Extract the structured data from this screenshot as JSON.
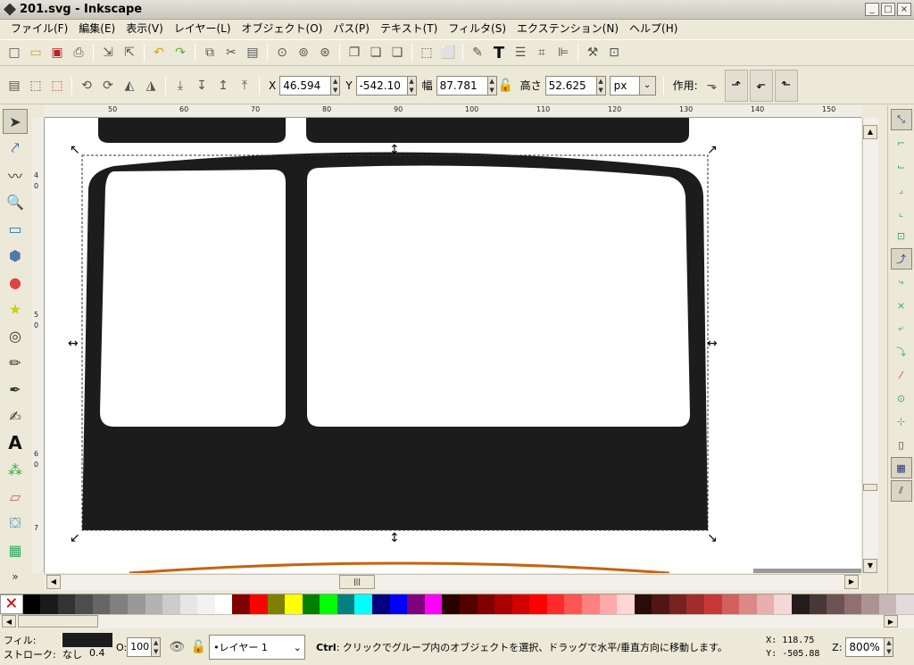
{
  "window": {
    "title": "201.svg - Inkscape",
    "minimize": "_",
    "maximize": "□",
    "close": "×"
  },
  "menu": [
    "ファイル(F)",
    "編集(E)",
    "表示(V)",
    "レイヤー(L)",
    "オブジェクト(O)",
    "パス(P)",
    "テキスト(T)",
    "フィルタ(S)",
    "エクステンション(N)",
    "ヘルプ(H)"
  ],
  "toolbar1_icons": [
    "new-icon",
    "open-icon",
    "save-icon",
    "print-icon",
    "import-icon",
    "export-icon",
    "undo-icon",
    "redo-icon",
    "copy-icon",
    "cut-icon",
    "paste-icon",
    "zoom-selection-icon",
    "zoom-drawing-icon",
    "zoom-page-icon",
    "duplicate-icon",
    "clone-icon",
    "unlink-clone-icon",
    "group-icon",
    "ungroup-icon",
    "fill-stroke-icon",
    "text-font-icon",
    "layers-icon",
    "xml-editor-icon",
    "align-icon",
    "preferences-icon",
    "document-properties-icon"
  ],
  "selectbar": {
    "x_label": "X",
    "x_value": "46.594",
    "y_label": "Y",
    "y_value": "-542.10",
    "w_label": "幅",
    "w_value": "87.781",
    "h_label": "高さ",
    "h_value": "52.625",
    "unit": "px",
    "affect_label": "作用:"
  },
  "hruler_ticks": [
    "50",
    "60",
    "70",
    "80",
    "90",
    "100",
    "110",
    "120",
    "130",
    "140",
    "150"
  ],
  "vruler_ticks": [
    "4",
    "0",
    "5",
    "0",
    "6",
    "0",
    "7"
  ],
  "canvas": {
    "shape_color": "#1c1c1c",
    "accent_orange": "#c8620f",
    "page_background": "#ffffff"
  },
  "palette": [
    "#000000",
    "#1a1a1a",
    "#333333",
    "#4d4d4d",
    "#666666",
    "#808080",
    "#999999",
    "#b3b3b3",
    "#cccccc",
    "#e6e6e6",
    "#f2f2f2",
    "#ffffff",
    "#800000",
    "#ff0000",
    "#808000",
    "#ffff00",
    "#008000",
    "#00ff00",
    "#008080",
    "#00ffff",
    "#000080",
    "#0000ff",
    "#800080",
    "#ff00ff",
    "#2b0000",
    "#550000",
    "#800000",
    "#aa0000",
    "#d40000",
    "#ff0000",
    "#ff2a2a",
    "#ff5555",
    "#ff8080",
    "#ffaaaa",
    "#ffd5d5",
    "#280b0b",
    "#501616",
    "#782121",
    "#a02c2c",
    "#c83737",
    "#d35f5f",
    "#de8787",
    "#e9afaf",
    "#f4d7d7",
    "#241c1c",
    "#483737",
    "#6c5353",
    "#916f6f",
    "#ac9393",
    "#c8b7b7",
    "#e3dbdb"
  ],
  "status": {
    "fill_label": "フィル:",
    "stroke_label": "ストローク:",
    "stroke_value": "なし",
    "stroke_width": "0.4",
    "opacity_label": "O:",
    "opacity_value": "100",
    "layer_name": "•レイヤー 1",
    "message_key": "Ctrl",
    "message": ": クリックでグループ内のオブジェクトを選択、ドラッグで水平/垂直方向に移動します。",
    "x_coord": "X:  118.75",
    "y_coord": "Y: -505.88",
    "zoom_label": "Z:",
    "zoom_value": "800%"
  }
}
